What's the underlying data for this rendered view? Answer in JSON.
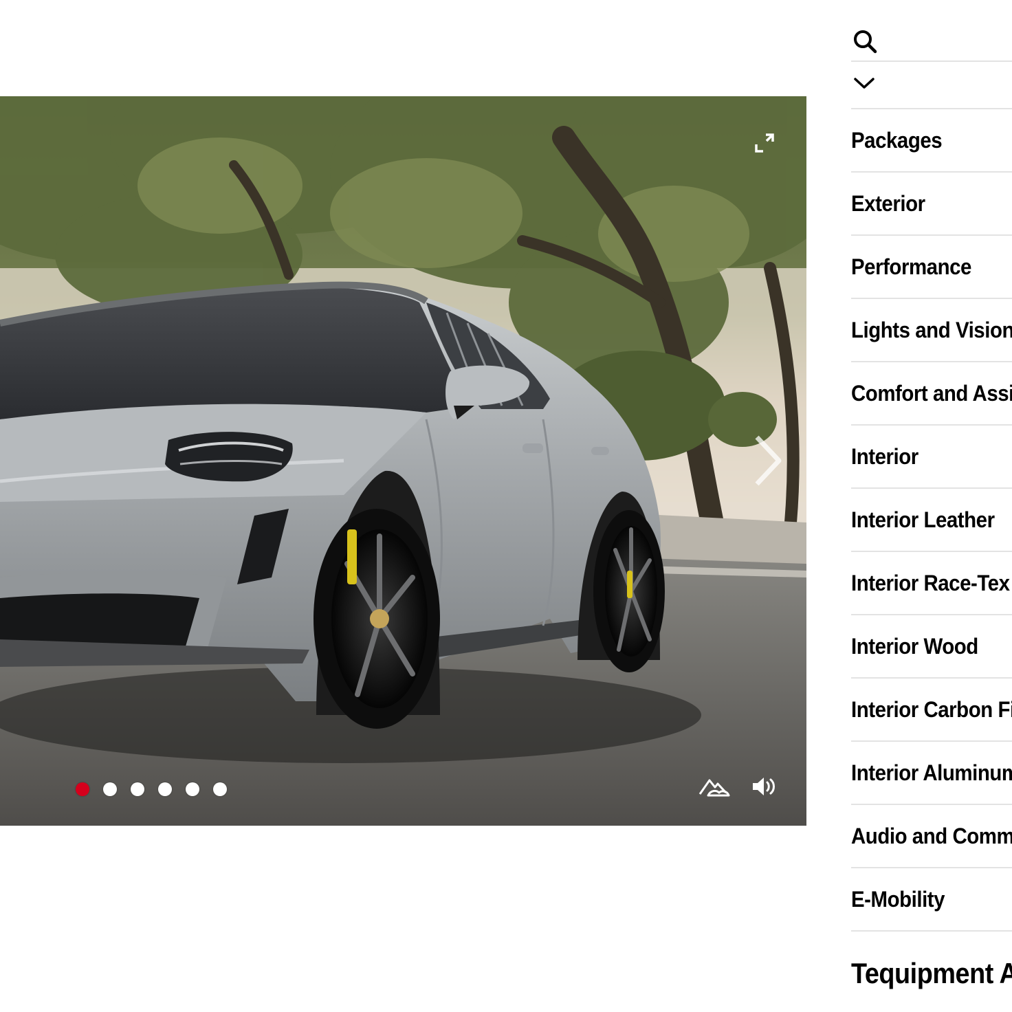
{
  "viewer": {
    "scene": "grey-sports-sedan-under-trees",
    "slides_total": 6,
    "active_slide": 1,
    "icons": {
      "fullscreen": "expand-icon",
      "next": "chevron-right-icon",
      "environment": "landscape-icon",
      "sound": "speaker-icon"
    }
  },
  "panel": {
    "icons": {
      "search": "search-icon",
      "collapse": "chevron-down-icon"
    },
    "menu": [
      {
        "label": "Packages"
      },
      {
        "label": "Exterior"
      },
      {
        "label": "Performance"
      },
      {
        "label": "Lights and Vision"
      },
      {
        "label": "Comfort and Assistance"
      },
      {
        "label": "Interior"
      },
      {
        "label": "Interior Leather"
      },
      {
        "label": "Interior Race-Tex"
      },
      {
        "label": "Interior Wood"
      },
      {
        "label": "Interior Carbon Fiber"
      },
      {
        "label": "Interior Aluminum"
      },
      {
        "label": "Audio and Communication"
      },
      {
        "label": "E-Mobility"
      }
    ],
    "equipment_heading": "Tequipment Accessories"
  },
  "colors": {
    "accent_dot": "#d5001c",
    "divider": "#e3e3e3",
    "car_body": "#a7abad"
  }
}
